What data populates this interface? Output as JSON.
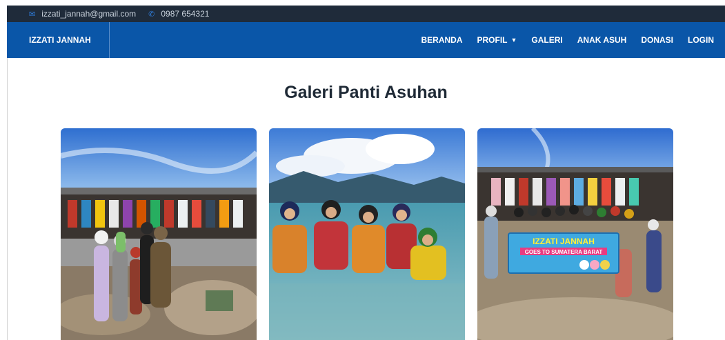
{
  "topbar": {
    "email": "izzati_jannah@gmail.com",
    "phone": "0987 654321",
    "email_icon": "envelope-icon",
    "phone_icon": "phone-icon"
  },
  "navbar": {
    "brand": "IZZATI JANNAH",
    "menu": [
      {
        "label": "BERANDA"
      },
      {
        "label": "PROFIL"
      },
      {
        "label": "GALERI"
      },
      {
        "label": "ANAK ASUH"
      },
      {
        "label": "DONASI"
      },
      {
        "label": "LOGIN"
      }
    ]
  },
  "page": {
    "title": "Galeri Panti Asuhan"
  },
  "gallery": {
    "banner_title": "IZZATI JANNAH",
    "banner_subtitle": "GOES TO SUMATERA BARAT"
  },
  "colors": {
    "topbar_bg": "#1f2b3a",
    "navbar_bg": "#0a56a8",
    "accent": "#2f7fe0"
  }
}
